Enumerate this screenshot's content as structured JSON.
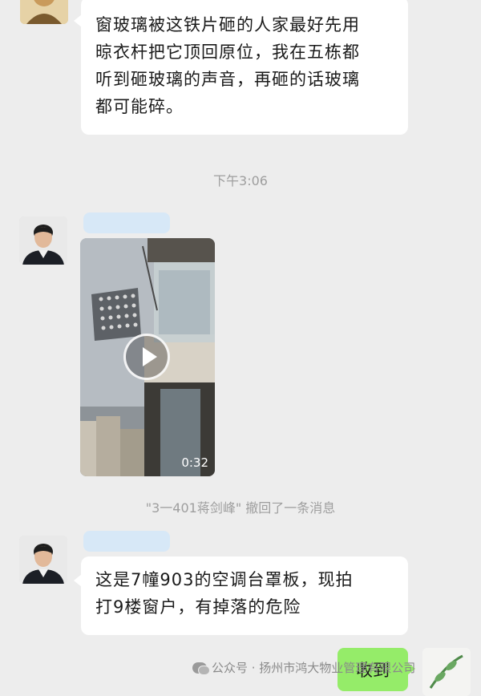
{
  "chat": {
    "messages": [
      {
        "lines": [
          "窗玻璃被这铁片砸的人家最好先用",
          "晾衣杆把它顶回原位，我在五栋都",
          "听到砸玻璃的声音，再砸的话玻璃",
          "都可能碎。"
        ]
      },
      {
        "lines": [
          "这是7幢903的空调台罩板，现拍",
          "打9楼窗户，有掉落的危险"
        ]
      }
    ],
    "timestamp": "下午3:06",
    "video": {
      "duration": "0:32",
      "icon": "play-icon"
    },
    "recall_notice": "\"3一401蒋剑峰\" 撤回了一条消息",
    "my_reply": "收到"
  },
  "watermark": {
    "text": "公众号 · 扬州市鸿大物业管理有限公司",
    "icon": "wechat-icon"
  },
  "colors": {
    "background": "#ededed",
    "bubble_in": "#ffffff",
    "bubble_out": "#95ec69",
    "meta_text": "#9e9e9e"
  }
}
